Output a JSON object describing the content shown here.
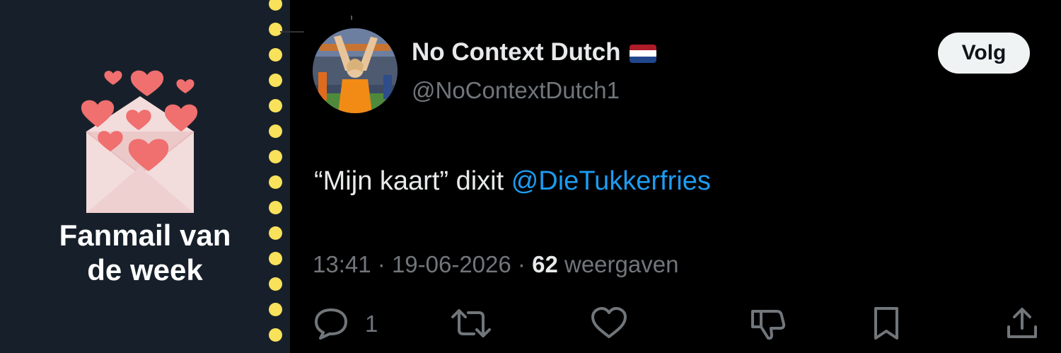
{
  "fanmail": {
    "title_line1": "Fanmail van",
    "title_line2": "de week",
    "dot_color": "#f8e15b",
    "panel_color": "#17202a",
    "envelope_icon": "envelope-with-hearts-icon"
  },
  "tweet": {
    "display_name": "No Context Dutch",
    "flag_icon": "netherlands-flag-icon",
    "handle": "@NoContextDutch1",
    "follow_label": "Volg",
    "text_prefix": "“Mijn kaart” dixit ",
    "mention": "@DieTukkerfries",
    "time": "13:41",
    "separator": "·",
    "date": "19-06-2026",
    "views_count": "62",
    "views_label": "weergaven",
    "reply_count": "1",
    "mention_color": "#1d9bf0"
  },
  "actions": {
    "reply_icon": "reply-bubble-icon",
    "retweet_icon": "retweet-icon",
    "like_icon": "heart-icon",
    "dislike_icon": "thumbs-down-icon",
    "bookmark_icon": "bookmark-icon",
    "share_icon": "share-icon"
  }
}
